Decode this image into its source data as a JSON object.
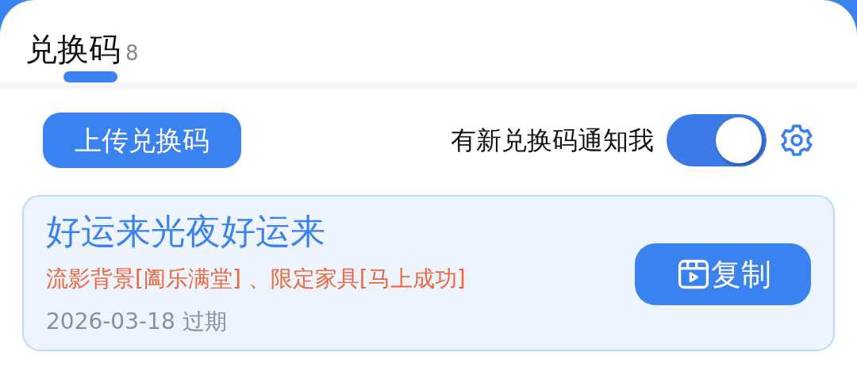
{
  "tabs": [
    {
      "label": "兑换码",
      "count": "8",
      "selected": true
    }
  ],
  "upload_button": "上传兑换码",
  "notify": {
    "label": "有新兑换码通知我",
    "on": true
  },
  "codes": [
    {
      "code": "好运来光夜好运来",
      "rewards": "流影背景[阖乐满堂] 、限定家具[马上成功]",
      "date": "2026-03-18 过期",
      "copy_label": "复制"
    }
  ]
}
